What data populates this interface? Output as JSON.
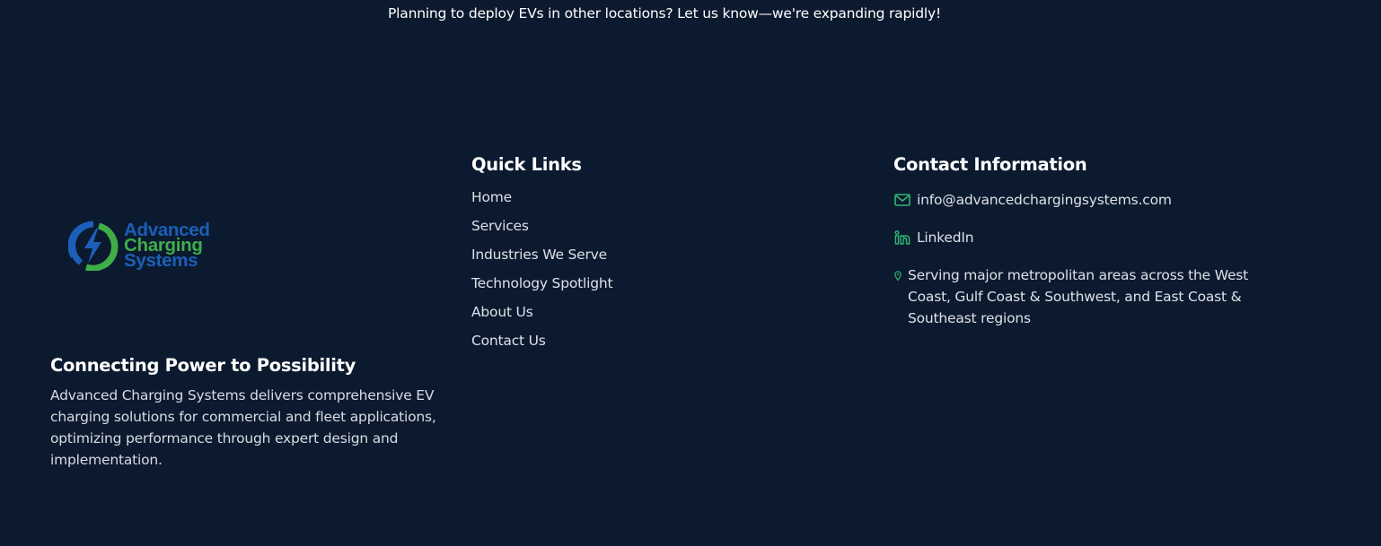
{
  "banner": {
    "text": "Planning to deploy EVs in other locations? Let us know—we're expanding rapidly!"
  },
  "brand": {
    "logo_line1": "Advanced",
    "logo_line2": "Charging",
    "logo_line3": "Systems",
    "colors": {
      "blue": "#1c5fb8",
      "green": "#3fae49"
    },
    "tagline": "Connecting Power to Possibility",
    "description": "Advanced Charging Systems delivers comprehensive EV charging solutions for commercial and fleet applications, optimizing performance through expert design and implementation."
  },
  "quick_links": {
    "title": "Quick Links",
    "items": [
      {
        "label": "Home"
      },
      {
        "label": "Services"
      },
      {
        "label": "Industries We Serve"
      },
      {
        "label": "Technology Spotlight"
      },
      {
        "label": "About Us"
      },
      {
        "label": "Contact Us"
      }
    ]
  },
  "contact": {
    "title": "Contact Information",
    "email": "info@advancedchargingsystems.com",
    "email_icon": "envelope-icon",
    "linkedin": "LinkedIn",
    "linkedin_icon": "linkedin-icon",
    "location": "Serving major metropolitan areas across the West Coast, Gulf Coast & Southwest, and East Coast & Southeast regions",
    "location_icon": "map-pin-icon",
    "icon_color": "#2fb673"
  },
  "theme": {
    "background": "#0b1a2f",
    "text": "#dde1e8"
  }
}
